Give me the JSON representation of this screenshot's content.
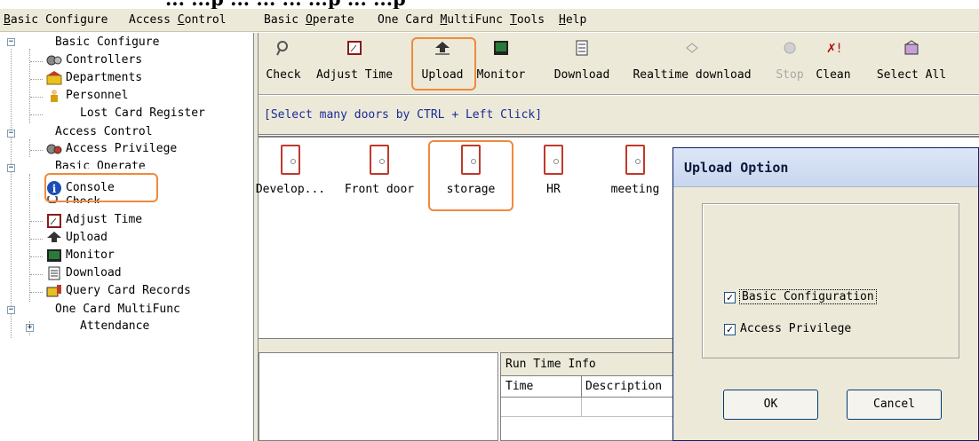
{
  "top_strip_text": [
    "... ...p ... ...   ... ...p ... ...p"
  ],
  "menu": [
    {
      "label": "Basic Configure",
      "underline_char": "B"
    },
    {
      "label": "Access Control",
      "underline_char": "C"
    },
    {
      "label": "Basic Operate",
      "underline_char": "O"
    },
    {
      "label": "One Card MultiFunc",
      "underline_char": "M"
    },
    {
      "label": "Tools",
      "underline_char": "T"
    },
    {
      "label": "Help",
      "underline_char": "H"
    }
  ],
  "tree": {
    "basic_configure": "Basic Configure",
    "controllers": "Controllers",
    "departments": "Departments",
    "personnel": "Personnel",
    "lost_card_register": "Lost Card Register",
    "access_control": "Access Control",
    "access_privilege": "Access Privilege",
    "basic_operate": "Basic Operate",
    "console": "Console",
    "check": "Check",
    "adjust_time": "Adjust Time",
    "upload": "Upload",
    "monitor": "Monitor",
    "download": "Download",
    "query_card_records": "Query Card Records",
    "one_card_multifunc": "One Card MultiFunc",
    "attendance": "Attendance",
    "expander_collapse": "−",
    "expander_expand": "+"
  },
  "toolbar": {
    "check": "Check",
    "adjust_time": "Adjust Time",
    "upload": "Upload",
    "monitor": "Monitor",
    "download": "Download",
    "realtime_download": "Realtime download",
    "stop": "Stop",
    "clean": "Clean",
    "select_all": "Select All"
  },
  "hint": "[Select many doors by CTRL + Left Click]",
  "doors": [
    {
      "label": "Develop..."
    },
    {
      "label": "Front door"
    },
    {
      "label": "storage",
      "selected": true
    },
    {
      "label": "HR"
    },
    {
      "label": "meeting"
    }
  ],
  "run_time_info": {
    "title": "Run Time Info",
    "col_time": "Time",
    "col_description": "Description"
  },
  "dialog": {
    "title": "Upload Option",
    "option1": "Basic Configuration",
    "option1_checked": "✓",
    "option2": "Access Privilege",
    "option2_checked": "✓",
    "ok": "OK",
    "cancel": "Cancel"
  },
  "colors": {
    "highlight": "#f08a3c",
    "chrome": "#ece9d8",
    "door_red": "#c0392b",
    "hint_blue": "#1a2a9a"
  }
}
